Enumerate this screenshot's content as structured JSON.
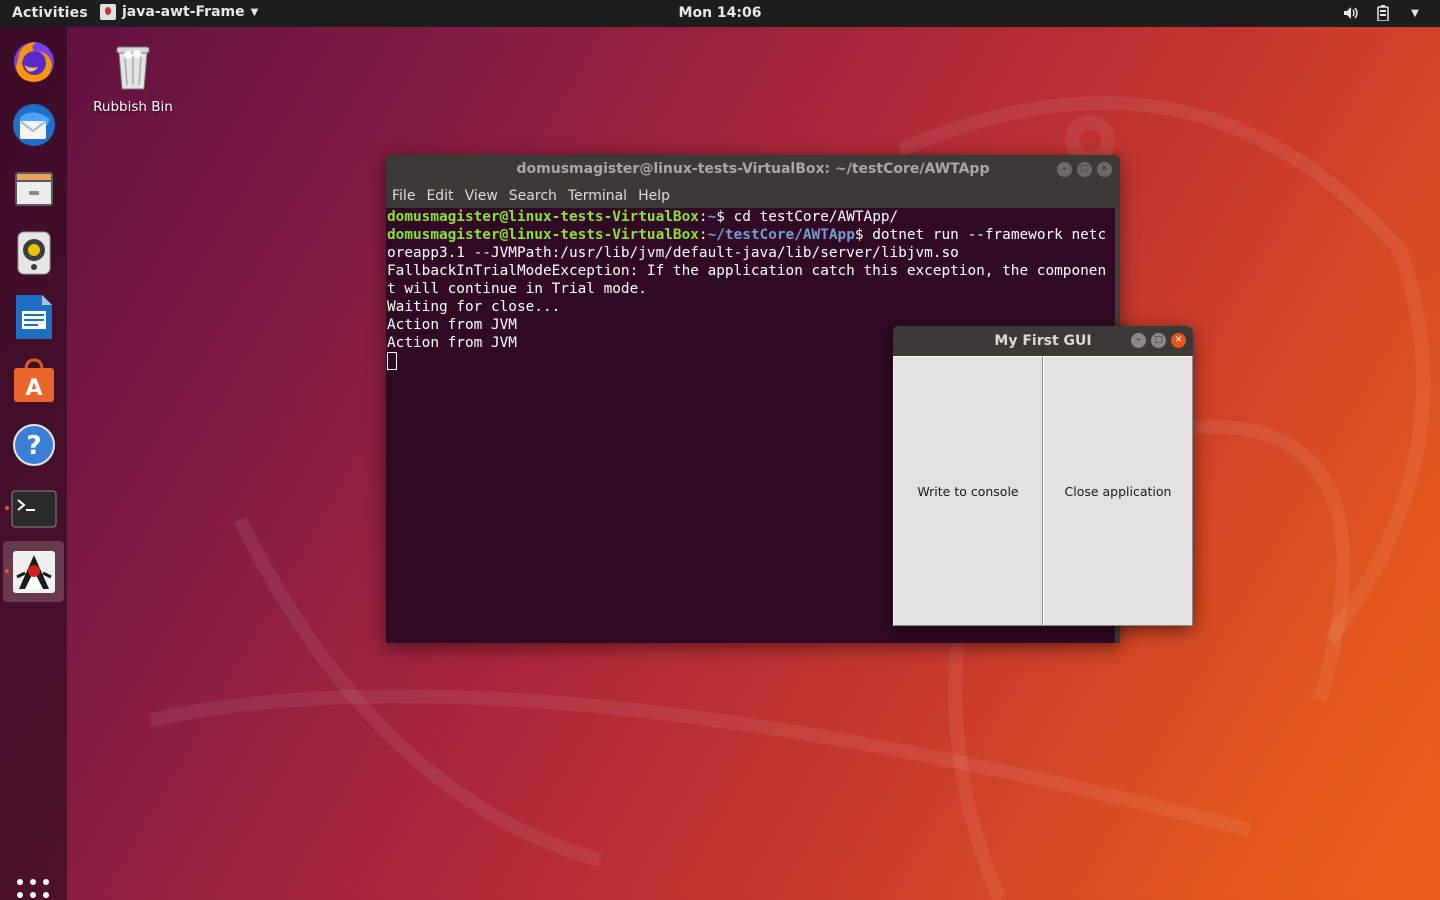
{
  "topbar": {
    "activities_label": "Activities",
    "app_menu_label": "java-awt-Frame",
    "clock": "Mon 14:06"
  },
  "desktop": {
    "rubbish_bin_label": "Rubbish Bin"
  },
  "dock": {
    "items": [
      {
        "name": "firefox",
        "active": false
      },
      {
        "name": "thunderbird",
        "active": false
      },
      {
        "name": "files",
        "active": false
      },
      {
        "name": "rhythmbox",
        "active": false
      },
      {
        "name": "libreoffice-writer",
        "active": false
      },
      {
        "name": "ubuntu-software",
        "active": false
      },
      {
        "name": "help",
        "active": false
      },
      {
        "name": "terminal",
        "active": false,
        "running": true
      },
      {
        "name": "java",
        "active": true,
        "running": true
      }
    ]
  },
  "terminal": {
    "title": "domusmagister@linux-tests-VirtualBox: ~/testCore/AWTApp",
    "menu": [
      "File",
      "Edit",
      "View",
      "Search",
      "Terminal",
      "Help"
    ],
    "prompt_user": "domusmagister@linux-tests-VirtualBox",
    "line1_path": "~",
    "line1_cmd": "$ cd testCore/AWTApp/",
    "line2_path": "~/testCore/AWTApp",
    "line2_cmd": "$ dotnet run --framework netcoreapp3.1 --JVMPath:/usr/lib/jvm/default-java/lib/server/libjvm.so",
    "output": [
      "FallbackInTrialModeException: If the application catch this exception, the component will continue in Trial mode.",
      "Waiting for close...",
      "Action from JVM",
      "Action from JVM"
    ]
  },
  "awt_window": {
    "title": "My First GUI",
    "write_button_label": "Write to console",
    "close_button_label": "Close application"
  },
  "colors": {
    "terminal_bg": "#300a24",
    "prompt_user": "#8ae234",
    "prompt_path": "#729fcf",
    "accent": "#e9541f"
  }
}
